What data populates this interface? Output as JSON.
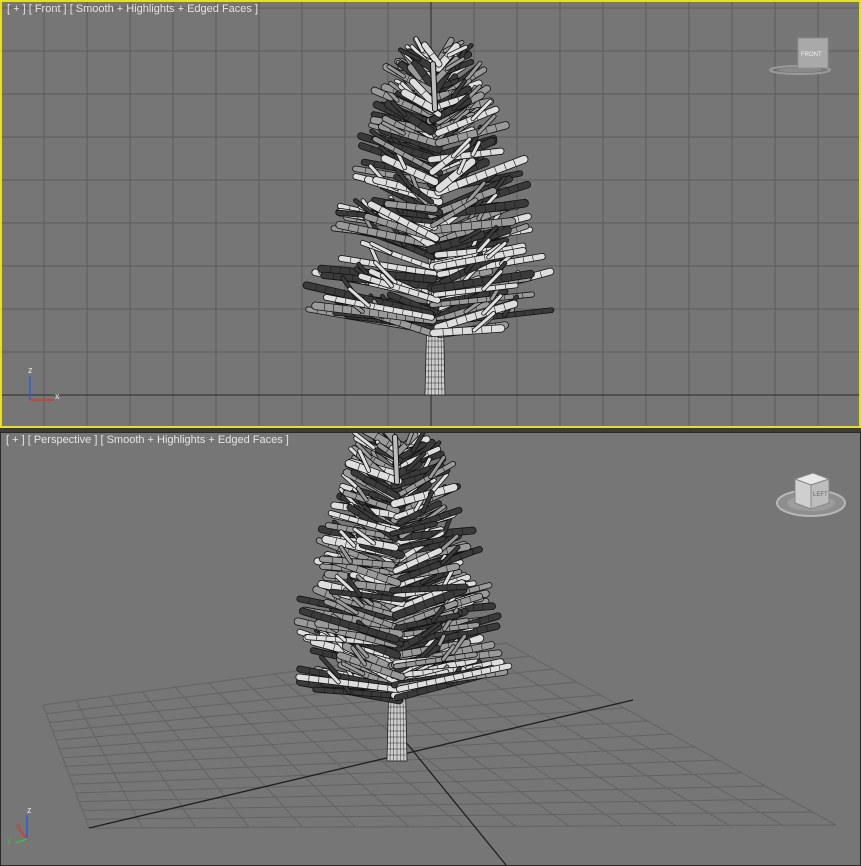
{
  "viewports": [
    {
      "id": "front",
      "label_menu": "[ + ]",
      "label_view": "[ Front ]",
      "label_shading": "[ Smooth + Highlights + Edged Faces ]",
      "viewcube_face": "FRONT",
      "active": true,
      "axes": {
        "vertical": "z",
        "horizontal": "x"
      }
    },
    {
      "id": "perspective",
      "label_menu": "[ + ]",
      "label_view": "[ Perspective ]",
      "label_shading": "[ Smooth + Highlights + Edged Faces ]",
      "viewcube_face": "LEFT",
      "active": false,
      "axes": {
        "vertical": "z",
        "horizontal": "x",
        "depth": "y"
      }
    }
  ],
  "colors": {
    "viewport_bg": "#767676",
    "grid_line": "#5c5c5c",
    "grid_main": "#2b2b2b",
    "active_border": "#e7dd2b",
    "axis_x": "#d63a2b",
    "axis_y": "#3fb94a",
    "axis_z": "#2d5fd6"
  },
  "icons": [
    "viewcube-icon",
    "axis-tripod-icon",
    "tree-model"
  ]
}
